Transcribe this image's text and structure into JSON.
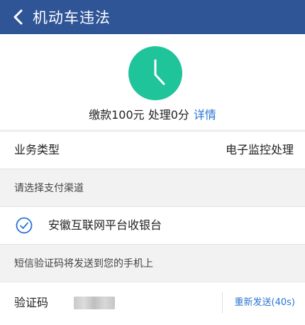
{
  "header": {
    "title": "机动车违法"
  },
  "summary": {
    "status_text": "缴款100元 处理0分",
    "detail_link": "详情"
  },
  "business": {
    "label": "业务类型",
    "value": "电子监控处理"
  },
  "payment": {
    "hint": "请选择支付渠道",
    "cashier_label": "安徽互联网平台收银台"
  },
  "sms": {
    "hint": "短信验证码将发送到您的手机上",
    "code_label": "验证码",
    "resend_label": "重新发送(40s)"
  },
  "colors": {
    "header_bg": "#2f5597",
    "accent": "#2a74d2",
    "clock": "#20c49a"
  }
}
